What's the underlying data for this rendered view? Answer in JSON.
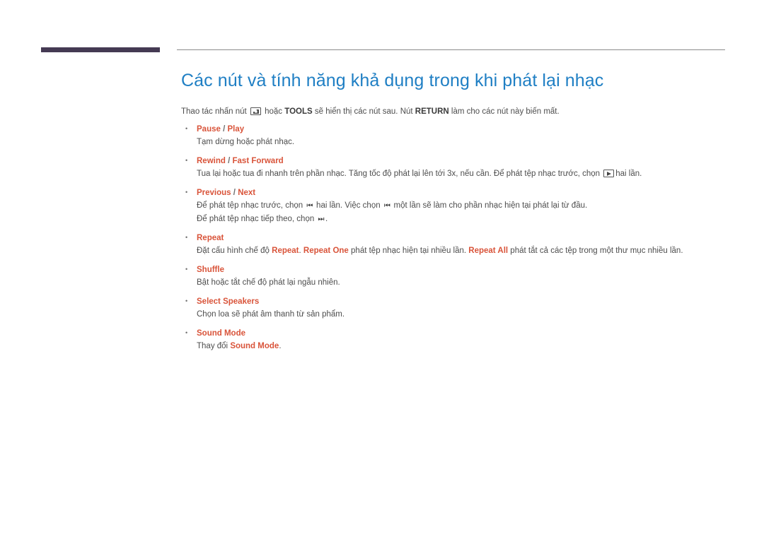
{
  "header": {
    "tab_bar_color": "#453a53",
    "rule_color": "#8a8a8a"
  },
  "page": {
    "title": "Các nút và tính năng khả dụng trong khi phát lại nhạc",
    "title_color": "#1f7fc4",
    "accent_color": "#d9543a",
    "body_color": "#4d4d4d"
  },
  "intro": {
    "part1": "Thao tác nhấn nút",
    "icon1": "enter-key-icon",
    "part2": "hoặc",
    "tools_label": "TOOLS",
    "part3": "sẽ hiển thị các nút sau. Nút",
    "return_label": "RETURN",
    "part4": "làm cho các nút này biến mất."
  },
  "features": [
    {
      "title_parts": [
        "Pause",
        "/",
        "Play"
      ],
      "lines": [
        {
          "segments": [
            {
              "text": "Tạm dừng hoặc phát nhạc.",
              "style": "normal"
            }
          ]
        }
      ]
    },
    {
      "title_parts": [
        "Rewind",
        "/",
        "Fast Forward"
      ],
      "lines": [
        {
          "segments": [
            {
              "text": "Tua lại hoặc tua đi nhanh trên phần nhạc. Tăng tốc độ phát lại lên tới 3x, nếu cần. Để phát tệp nhạc trước, chọn",
              "style": "normal"
            },
            {
              "text": "",
              "style": "icon-play"
            },
            {
              "text": "hai lần.",
              "style": "normal"
            }
          ]
        }
      ]
    },
    {
      "title_parts": [
        "Previous",
        "/",
        "Next"
      ],
      "lines": [
        {
          "segments": [
            {
              "text": "Để phát tệp nhạc trước, chọn",
              "style": "normal"
            },
            {
              "text": "⏮",
              "style": "glyph"
            },
            {
              "text": "hai lần. Việc chọn",
              "style": "normal"
            },
            {
              "text": "⏮",
              "style": "glyph"
            },
            {
              "text": "một lần sẽ làm cho phần nhạc hiện tại phát lại từ đầu.",
              "style": "normal"
            }
          ]
        },
        {
          "segments": [
            {
              "text": "Để phát tệp nhạc tiếp theo, chọn",
              "style": "normal"
            },
            {
              "text": "⏭",
              "style": "glyph"
            },
            {
              "text": ".",
              "style": "normal"
            }
          ]
        }
      ]
    },
    {
      "title_parts": [
        "Repeat"
      ],
      "lines": [
        {
          "segments": [
            {
              "text": "Đặt cấu hình chế độ",
              "style": "normal"
            },
            {
              "text": "Repeat",
              "style": "highlight"
            },
            {
              "text": ".",
              "style": "normal"
            },
            {
              "text": "Repeat One",
              "style": "highlight"
            },
            {
              "text": "phát tệp nhạc hiện tại nhiều lần.",
              "style": "normal"
            },
            {
              "text": "Repeat All",
              "style": "highlight"
            },
            {
              "text": "phát tắt cả các tệp trong một thư mục nhiều lần.",
              "style": "normal"
            }
          ]
        }
      ]
    },
    {
      "title_parts": [
        "Shuffle"
      ],
      "lines": [
        {
          "segments": [
            {
              "text": "Bật hoặc tắt chế độ phát lại ngẫu nhiên.",
              "style": "normal"
            }
          ]
        }
      ]
    },
    {
      "title_parts": [
        "Select Speakers"
      ],
      "lines": [
        {
          "segments": [
            {
              "text": "Chọn loa sẽ phát âm thanh từ sản phẩm.",
              "style": "normal"
            }
          ]
        }
      ]
    },
    {
      "title_parts": [
        "Sound Mode"
      ],
      "lines": [
        {
          "segments": [
            {
              "text": "Thay đổi",
              "style": "normal"
            },
            {
              "text": "Sound Mode",
              "style": "highlight"
            },
            {
              "text": ".",
              "style": "normal"
            }
          ]
        }
      ]
    }
  ]
}
